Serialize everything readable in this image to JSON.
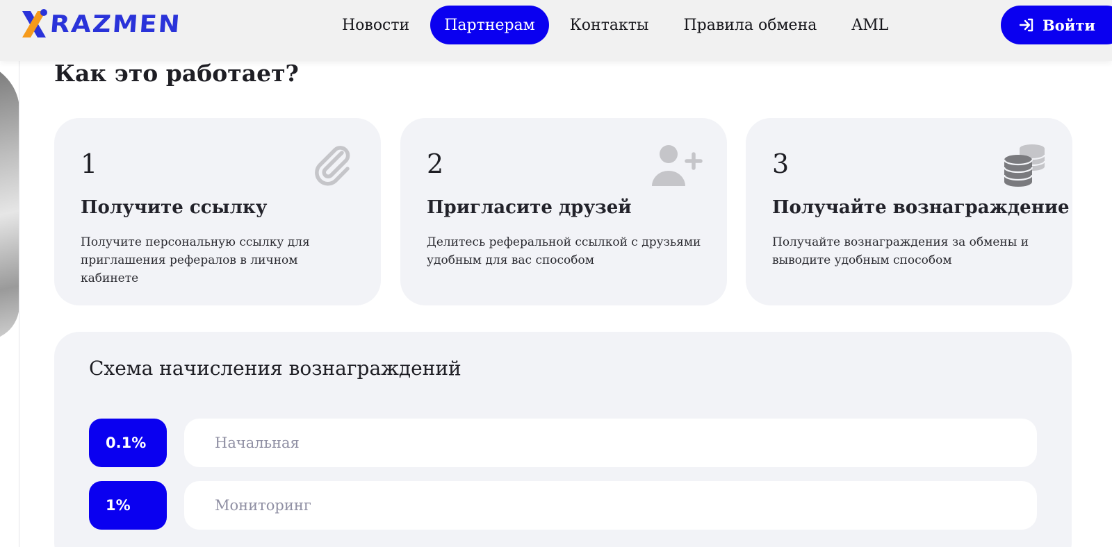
{
  "header": {
    "logo_text": "RAZMEN",
    "nav": [
      {
        "label": "Новости",
        "active": false
      },
      {
        "label": "Партнерам",
        "active": true
      },
      {
        "label": "Контакты",
        "active": false
      },
      {
        "label": "Правила обмена",
        "active": false
      },
      {
        "label": "AML",
        "active": false
      }
    ],
    "login_label": "Войти",
    "login_icon": "sign-in-arrow-icon"
  },
  "how_it_works": {
    "title": "Как это работает?",
    "steps": [
      {
        "number": "1",
        "title": "Получите ссылку",
        "description": "Получите персональную ссылку для приглашения рефералов в личном кабинете",
        "icon": "paperclip-icon"
      },
      {
        "number": "2",
        "title": "Пригласите друзей",
        "description": "Делитесь реферальной ссылкой с друзьями удобным для вас способом",
        "icon": "user-plus-icon"
      },
      {
        "number": "3",
        "title": "Получайте вознаграждение",
        "description": "Получайте вознаграждения за обмены и выводите удобным способом",
        "icon": "coins-icon"
      }
    ]
  },
  "rewards": {
    "title": "Схема начисления вознаграждений",
    "tiers": [
      {
        "percent": "0.1%",
        "name": "Начальная"
      },
      {
        "percent": "1%",
        "name": "Мониторинг"
      }
    ]
  },
  "colors": {
    "accent": "#0a00f0",
    "logo_blue": "#2a33d9",
    "logo_orange": "#f59a1b",
    "card_bg": "#f2f3f7",
    "icon_gray": "#c5c5c9"
  }
}
